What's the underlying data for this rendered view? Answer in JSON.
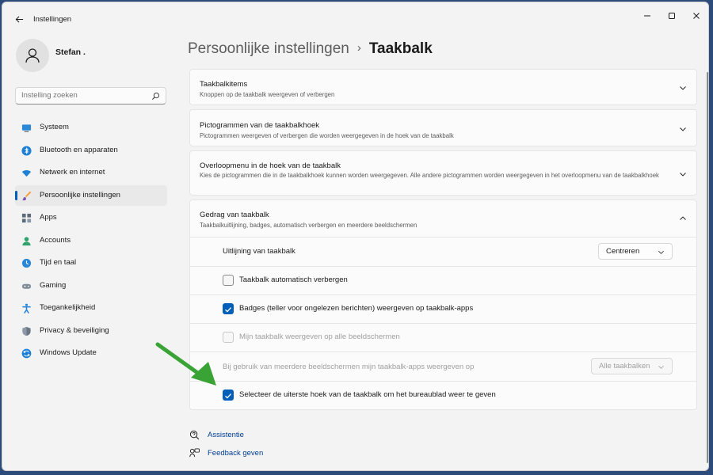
{
  "window": {
    "title": "Instellingen"
  },
  "user": {
    "name": "Stefan ."
  },
  "search": {
    "placeholder": "Instelling zoeken"
  },
  "sidebar": {
    "items": [
      {
        "label": "Systeem",
        "icon": "monitor-icon"
      },
      {
        "label": "Bluetooth en apparaten",
        "icon": "bluetooth-icon"
      },
      {
        "label": "Netwerk en internet",
        "icon": "wifi-icon"
      },
      {
        "label": "Persoonlijke instellingen",
        "icon": "brush-icon",
        "active": true
      },
      {
        "label": "Apps",
        "icon": "apps-icon"
      },
      {
        "label": "Accounts",
        "icon": "person-icon"
      },
      {
        "label": "Tijd en taal",
        "icon": "globe-clock-icon"
      },
      {
        "label": "Gaming",
        "icon": "gamepad-icon"
      },
      {
        "label": "Toegankelijkheid",
        "icon": "accessibility-icon"
      },
      {
        "label": "Privacy & beveiliging",
        "icon": "shield-icon"
      },
      {
        "label": "Windows Update",
        "icon": "update-icon"
      }
    ]
  },
  "breadcrumb": {
    "parent": "Persoonlijke instellingen",
    "separator": "›",
    "current": "Taakbalk"
  },
  "cards": [
    {
      "title": "Taakbalkitems",
      "desc": "Knoppen op de taakbalk weergeven of verbergen"
    },
    {
      "title": "Pictogrammen van de taakbalkhoek",
      "desc": "Pictogrammen weergeven of verbergen die worden weergegeven in de hoek van de taakbalk"
    },
    {
      "title": "Overloopmenu in de hoek van de taakbalk",
      "desc": "Kies de pictogrammen die in de taakbalkhoek kunnen worden weergegeven. Alle andere pictogrammen worden weergegeven in het overloopmenu van de taakbalkhoek"
    },
    {
      "title": "Gedrag van taakbalk",
      "desc": "Taakbalkuitlijning, badges, automatisch verbergen en meerdere beeldschermen"
    }
  ],
  "behavior": {
    "alignment": {
      "label": "Uitlijning van taakbalk",
      "value": "Centreren"
    },
    "autohide": {
      "label": "Taakbalk automatisch verbergen",
      "checked": false
    },
    "badges": {
      "label": "Badges (teller voor ongelezen berichten) weergeven op taakbalk-apps",
      "checked": true
    },
    "all_displays": {
      "label": "Mijn taakbalk weergeven op alle beeldschermen",
      "checked": false,
      "disabled": true
    },
    "multi_display_apps": {
      "label": "Bij gebruik van meerdere beeldschermen mijn taakbalk-apps weergeven op",
      "value": "Alle taakbalken",
      "disabled": true
    },
    "show_desktop": {
      "label": "Selecteer de uiterste hoek van de taakbalk om het bureaublad weer te geven",
      "checked": true
    }
  },
  "links": {
    "help": "Assistentie",
    "feedback": "Feedback geven"
  },
  "colors": {
    "accent": "#005fb8",
    "annotation_arrow": "#3aa335"
  }
}
